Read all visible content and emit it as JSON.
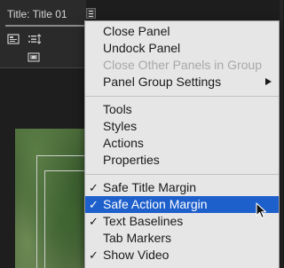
{
  "panel": {
    "title": "Title: Title 01",
    "menu_button_icon": "hamburger-icon",
    "tools": [
      "title-properties-icon",
      "align-distribute-icon",
      "safe-margin-icon"
    ]
  },
  "menu": {
    "items": [
      {
        "label": "Close Panel",
        "enabled": true
      },
      {
        "label": "Undock Panel",
        "enabled": true
      },
      {
        "label": "Close Other Panels in Group",
        "enabled": false
      },
      {
        "label": "Panel Group Settings",
        "enabled": true,
        "submenu": true
      },
      {
        "label": "Tools",
        "enabled": true
      },
      {
        "label": "Styles",
        "enabled": true
      },
      {
        "label": "Actions",
        "enabled": true
      },
      {
        "label": "Properties",
        "enabled": true
      },
      {
        "label": "Safe Title Margin",
        "enabled": true,
        "checked": true
      },
      {
        "label": "Safe Action Margin",
        "enabled": true,
        "checked": true,
        "highlighted": true
      },
      {
        "label": "Text Baselines",
        "enabled": true,
        "checked": true
      },
      {
        "label": "Tab Markers",
        "enabled": true,
        "checked": false
      },
      {
        "label": "Show Video",
        "enabled": true,
        "checked": true
      }
    ],
    "check_glyph": "✓"
  },
  "colors": {
    "menu_background": "#e6e6e6",
    "highlight": "#1d5fcb",
    "disabled_text": "#a8a8a8"
  }
}
